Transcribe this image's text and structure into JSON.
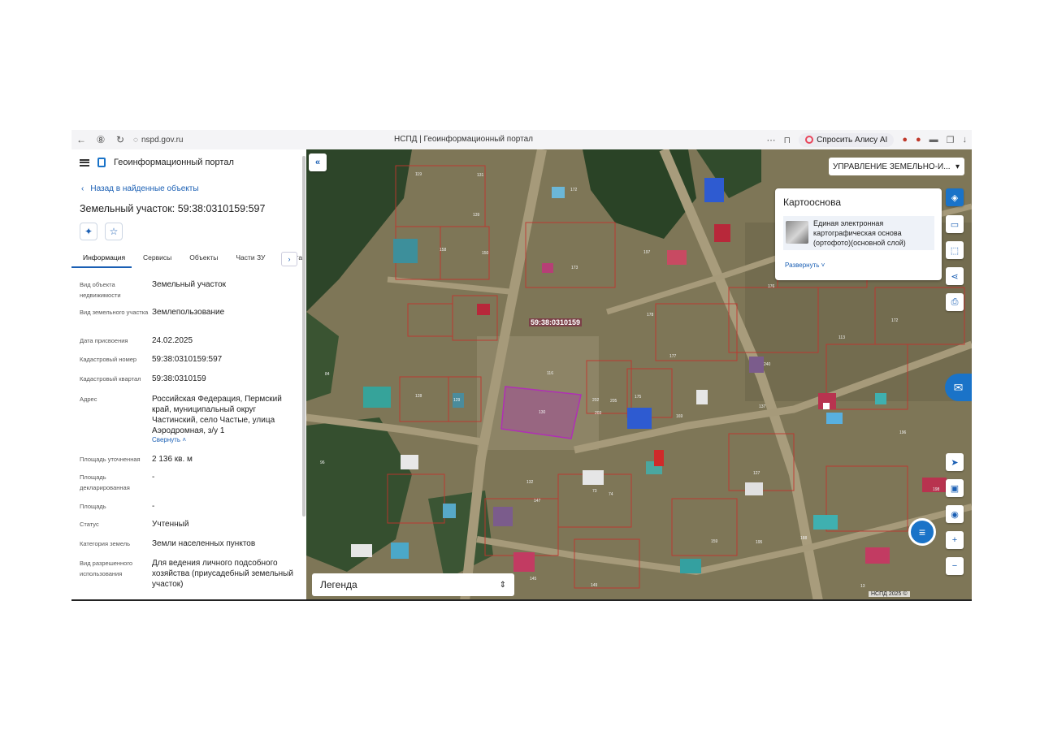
{
  "browser": {
    "url": "nspd.gov.ru",
    "tab_title": "НСПД | Геоинформационный портал",
    "alice_label": "Спросить Алису AI"
  },
  "sidebar": {
    "portal_title": "Геоинформационный портал",
    "back_link": "Назад в найденные объекты",
    "object_title": "Земельный участок: 59:38:0310159:597",
    "tabs": [
      {
        "label": "Информация",
        "active": true
      },
      {
        "label": "Сервисы",
        "active": false
      },
      {
        "label": "Объекты",
        "active": false
      },
      {
        "label": "Части ЗУ",
        "active": false
      },
      {
        "label": "Соста",
        "active": false
      }
    ],
    "attributes": [
      {
        "label": "Вид объекта недвижимости",
        "value": "Земельный участок"
      },
      {
        "label": "Вид земельного участка",
        "value": "Землепользование"
      },
      {
        "label": "Дата присвоения",
        "value": "24.02.2025"
      },
      {
        "label": "Кадастровый номер",
        "value": "59:38:0310159:597"
      },
      {
        "label": "Кадастровый квартал",
        "value": "59:38:0310159"
      },
      {
        "label": "Адрес",
        "value": "Российская Федерация, Пермский край, муниципальный округ Частинский, село Частые, улица Аэродромная, з/у 1"
      },
      {
        "label": "Площадь уточненная",
        "value": "2 136 кв. м"
      },
      {
        "label": "Площадь декларированная",
        "value": "-"
      },
      {
        "label": "Площадь",
        "value": "-"
      },
      {
        "label": "Статус",
        "value": "Учтенный"
      },
      {
        "label": "Категория земель",
        "value": "Земли населенных пунктов"
      },
      {
        "label": "Вид разрешенного использования",
        "value": "Для ведения личного подсобного хозяйства (приусадебный земельный участок)"
      }
    ],
    "collapse_label": "Свернуть"
  },
  "map": {
    "org_select": "УПРАВЛЕНИЕ ЗЕМЕЛЬНО-И...",
    "basemap_title": "Картооснова",
    "basemap_item": "Единая электронная картографическая основа (ортофото)(основной слой)",
    "expand_label": "Развернуть",
    "legend_label": "Легенда",
    "quarter_label": "59:38:0310159",
    "copyright": "НСПД 2025 ©",
    "parcel_color": "#b02fb5",
    "boundary_color": "#c2342d",
    "accent": "#1a73c8",
    "parcel_numbers": [
      "119",
      "131",
      "139",
      "172",
      "179",
      "158",
      "150",
      "197",
      "173",
      "178",
      "177",
      "176",
      "169",
      "116",
      "128",
      "129",
      "130",
      "202",
      "203",
      "205",
      "175",
      "240",
      "84",
      "96",
      "137",
      "113",
      "123",
      "127",
      "132",
      "147",
      "13",
      "73",
      "74",
      "149",
      "145",
      "188",
      "159",
      "195",
      "196",
      "198",
      "172"
    ]
  },
  "icons": {
    "nav_back": "←",
    "nav_forward": "→",
    "reload": "⟳",
    "shield": "◎",
    "menu_dots": "⋯",
    "bookmark": "⊓",
    "download": "↓"
  }
}
